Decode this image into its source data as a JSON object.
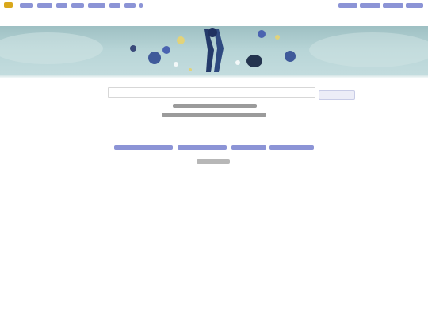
{
  "top_bar": {
    "left_links": [
      {
        "label": ""
      },
      {
        "label": ""
      },
      {
        "label": ""
      },
      {
        "label": ""
      },
      {
        "label": ""
      },
      {
        "label": ""
      },
      {
        "label": ""
      },
      {
        "label": ""
      }
    ],
    "right_links": [
      {
        "label": ""
      },
      {
        "label": ""
      },
      {
        "label": ""
      },
      {
        "label": ""
      }
    ]
  },
  "search": {
    "value": "",
    "placeholder": "",
    "button_label": ""
  },
  "caption": {
    "line1": "",
    "line2": ""
  },
  "bottom_links": [
    {
      "label": ""
    },
    {
      "label": ""
    },
    {
      "label": ""
    },
    {
      "label": ""
    }
  ],
  "footer": {
    "text": ""
  },
  "colors": {
    "link": "#8c94d6",
    "banner": "#b8d5d7",
    "accent": "#d9a81c"
  }
}
